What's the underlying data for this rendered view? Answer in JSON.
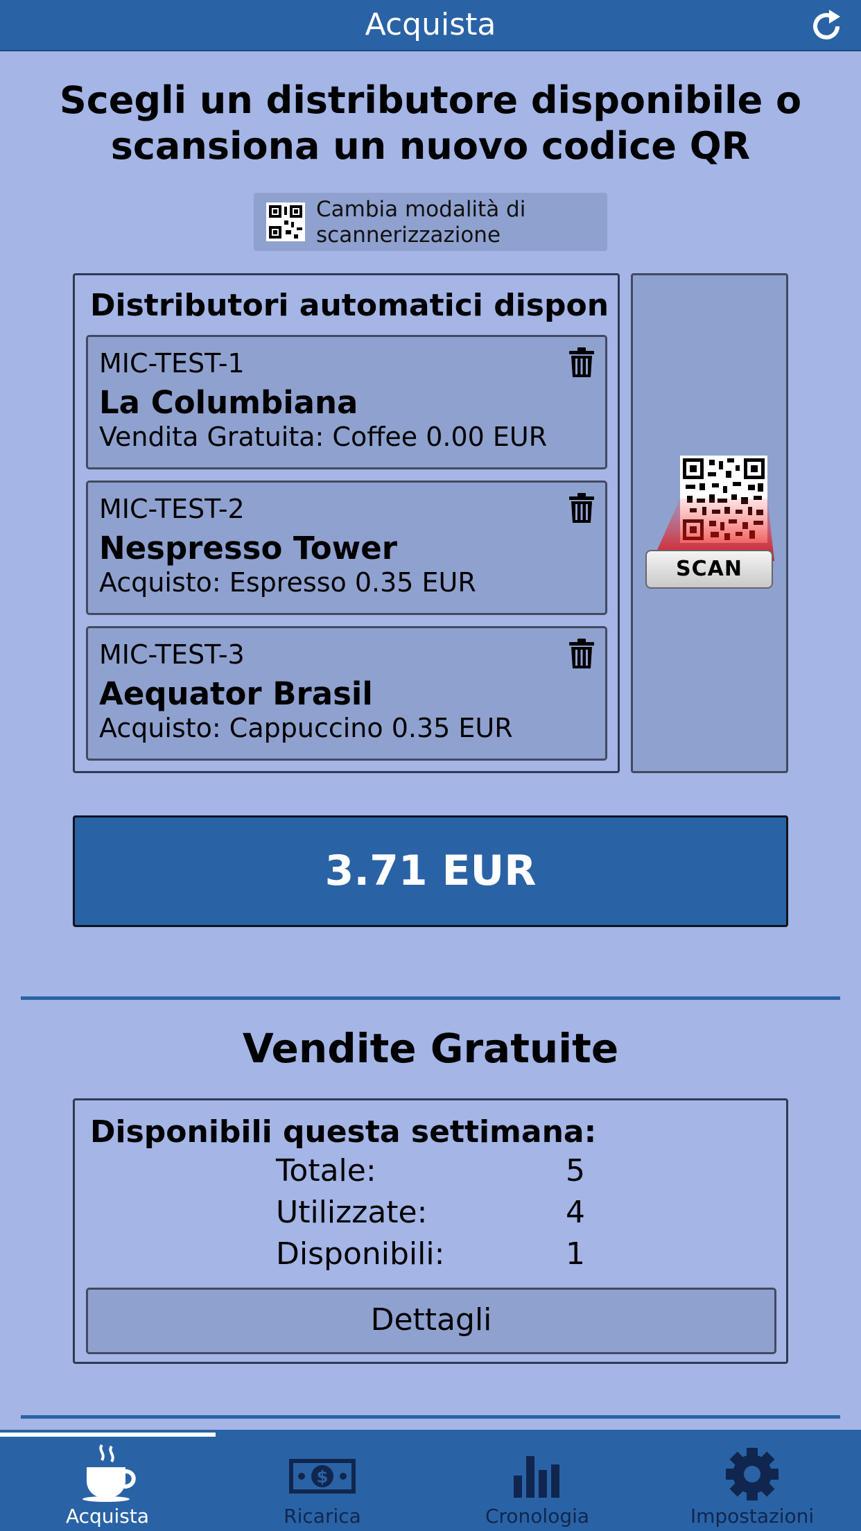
{
  "header": {
    "title": "Acquista",
    "refresh_icon": "refresh-icon"
  },
  "headline": "Scegli un distributore disponibile o scansiona un nuovo codice QR",
  "scan_mode_button": {
    "label": "Cambia modalità di scannerizzazione",
    "icon": "qr-code-icon"
  },
  "machines": {
    "title": "Distributori automatici dispon...",
    "items": [
      {
        "code": "MIC-TEST-1",
        "name": "La Columbiana",
        "detail": "Vendita Gratuita: Coffee 0.00 EUR"
      },
      {
        "code": "MIC-TEST-2",
        "name": "Nespresso Tower",
        "detail": "Acquisto: Espresso 0.35 EUR"
      },
      {
        "code": "MIC-TEST-3",
        "name": "Aequator Brasil",
        "detail": "Acquisto: Cappuccino 0.35 EUR"
      }
    ]
  },
  "scan": {
    "label": "SCAN"
  },
  "balance": "3.71 EUR",
  "free_sales": {
    "title": "Vendite Gratuite",
    "heading": "Disponibili questa settimana:",
    "stats": [
      {
        "label": "Totale:",
        "value": "5"
      },
      {
        "label": "Utilizzate:",
        "value": "4"
      },
      {
        "label": "Disponibili:",
        "value": "1"
      }
    ],
    "details_button": "Dettagli"
  },
  "tabs": [
    {
      "label": "Acquista",
      "icon": "coffee-cup-icon",
      "active": true
    },
    {
      "label": "Ricarica",
      "icon": "banknote-icon",
      "active": false
    },
    {
      "label": "Cronologia",
      "icon": "bar-chart-icon",
      "active": false
    },
    {
      "label": "Impostazioni",
      "icon": "gear-icon",
      "active": false
    }
  ],
  "colors": {
    "background": "#a4b5e6",
    "primary": "#2a63a5",
    "card": "#8fa1cf"
  }
}
